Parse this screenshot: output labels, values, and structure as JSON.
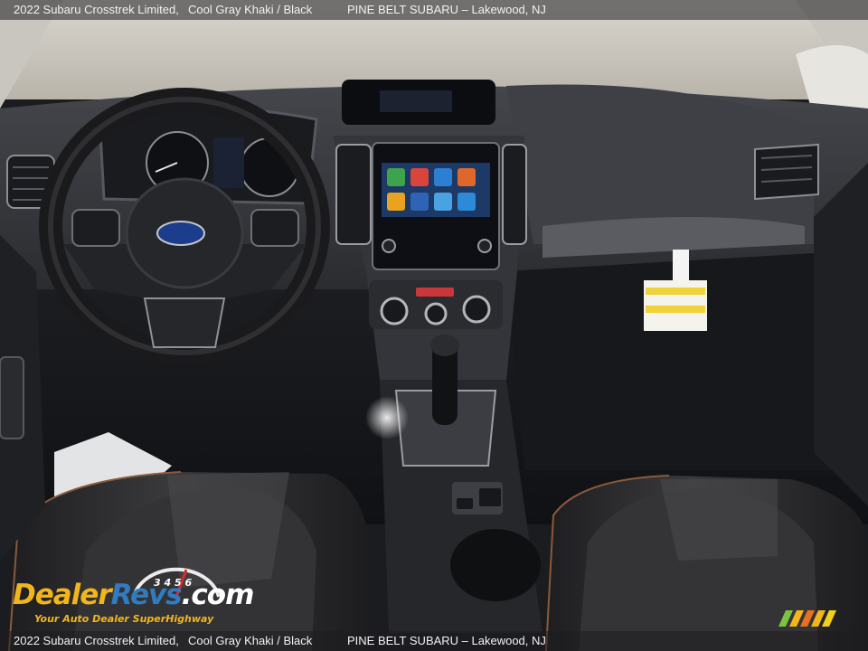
{
  "caption": {
    "model": "2022 Subaru Crosstrek Limited,",
    "color": "Cool Gray Khaki / Black",
    "dealer": "PINE BELT SUBARU – Lakewood, NJ"
  },
  "watermark": {
    "brand_part1": "Dealer",
    "brand_part2": "Revs",
    "brand_part3": ".com",
    "tagline": "Your Auto Dealer SuperHighway",
    "gauge_digits": "3 4 5 6"
  },
  "colors": {
    "caption_bg": "#1e1e20",
    "dashboard": "#2a2b2f",
    "seat_leather": "#2c2c2e",
    "watermark_gold": "#f2b61c",
    "watermark_blue": "#2f7cc3",
    "tag_yellow": "#f0d23a"
  },
  "icons": {
    "steering_badge": "subaru-oval-emblem",
    "corner_logo": "striped-badge-logo"
  }
}
